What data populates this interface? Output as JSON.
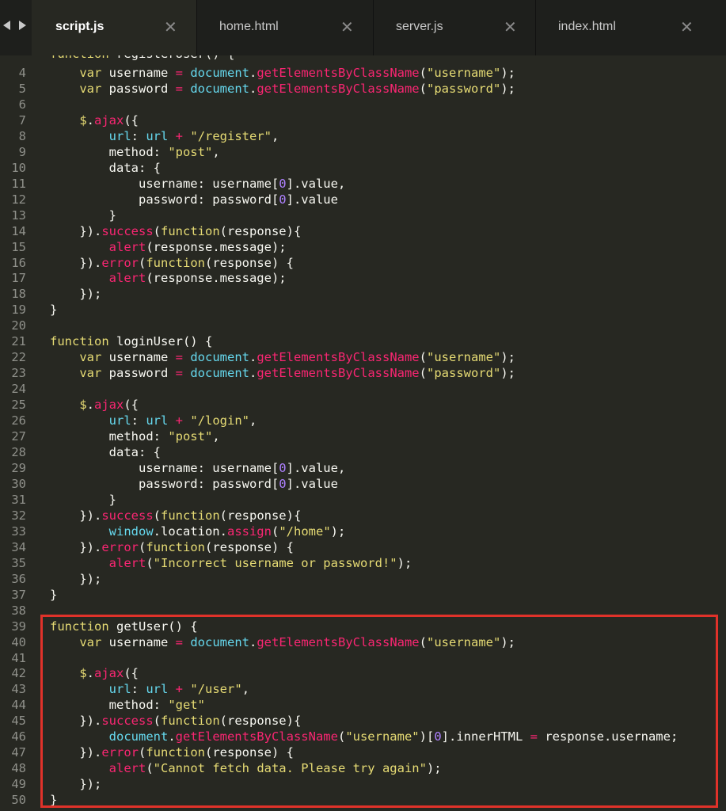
{
  "tabs": [
    {
      "label": "script.js",
      "active": true
    },
    {
      "label": "home.html",
      "active": false
    },
    {
      "label": "server.js",
      "active": false
    },
    {
      "label": "index.html",
      "active": false
    }
  ],
  "close_glyph": "✕",
  "colors": {
    "background": "#272822",
    "tab_bar": "#1e1f1c",
    "keyword": "#66d9ef",
    "function_name": "#a6e22e",
    "string": "#e6db74",
    "operator": "#f92672",
    "number": "#ae81ff",
    "highlight_border": "#e0322a"
  },
  "code": {
    "top_partial": "function registerUser() {",
    "lines": [
      {
        "n": "4",
        "text": "    var username = document.getElementsByClassName(\"username\");"
      },
      {
        "n": "5",
        "text": "    var password = document.getElementsByClassName(\"password\");"
      },
      {
        "n": "6",
        "text": ""
      },
      {
        "n": "7",
        "text": "    $.ajax({"
      },
      {
        "n": "8",
        "text": "        url: url + \"/register\","
      },
      {
        "n": "9",
        "text": "        method: \"post\","
      },
      {
        "n": "10",
        "text": "        data: {"
      },
      {
        "n": "11",
        "text": "            username: username[0].value,"
      },
      {
        "n": "12",
        "text": "            password: password[0].value"
      },
      {
        "n": "13",
        "text": "        }"
      },
      {
        "n": "14",
        "text": "    }).success(function(response){"
      },
      {
        "n": "15",
        "text": "        alert(response.message);"
      },
      {
        "n": "16",
        "text": "    }).error(function(response) {"
      },
      {
        "n": "17",
        "text": "        alert(response.message);"
      },
      {
        "n": "18",
        "text": "    });"
      },
      {
        "n": "19",
        "text": "}"
      },
      {
        "n": "20",
        "text": ""
      },
      {
        "n": "21",
        "text": "function loginUser() {"
      },
      {
        "n": "22",
        "text": "    var username = document.getElementsByClassName(\"username\");"
      },
      {
        "n": "23",
        "text": "    var password = document.getElementsByClassName(\"password\");"
      },
      {
        "n": "24",
        "text": ""
      },
      {
        "n": "25",
        "text": "    $.ajax({"
      },
      {
        "n": "26",
        "text": "        url: url + \"/login\","
      },
      {
        "n": "27",
        "text": "        method: \"post\","
      },
      {
        "n": "28",
        "text": "        data: {"
      },
      {
        "n": "29",
        "text": "            username: username[0].value,"
      },
      {
        "n": "30",
        "text": "            password: password[0].value"
      },
      {
        "n": "31",
        "text": "        }"
      },
      {
        "n": "32",
        "text": "    }).success(function(response){"
      },
      {
        "n": "33",
        "text": "        window.location.assign(\"/home\");"
      },
      {
        "n": "34",
        "text": "    }).error(function(response) {"
      },
      {
        "n": "35",
        "text": "        alert(\"Incorrect username or password!\");"
      },
      {
        "n": "36",
        "text": "    });"
      },
      {
        "n": "37",
        "text": "}"
      },
      {
        "n": "38",
        "text": ""
      },
      {
        "n": "39",
        "text": "function getUser() {"
      },
      {
        "n": "40",
        "text": "    var username = document.getElementsByClassName(\"username\");"
      },
      {
        "n": "41",
        "text": ""
      },
      {
        "n": "42",
        "text": "    $.ajax({"
      },
      {
        "n": "43",
        "text": "        url: url + \"/user\","
      },
      {
        "n": "44",
        "text": "        method: \"get\""
      },
      {
        "n": "45",
        "text": "    }).success(function(response){"
      },
      {
        "n": "46",
        "text": "        document.getElementsByClassName(\"username\")[0].innerHTML = response.username;"
      },
      {
        "n": "47",
        "text": "    }).error(function(response) {"
      },
      {
        "n": "48",
        "text": "        alert(\"Cannot fetch data. Please try again\");"
      },
      {
        "n": "49",
        "text": "    });"
      },
      {
        "n": "50",
        "text": "}"
      }
    ]
  }
}
